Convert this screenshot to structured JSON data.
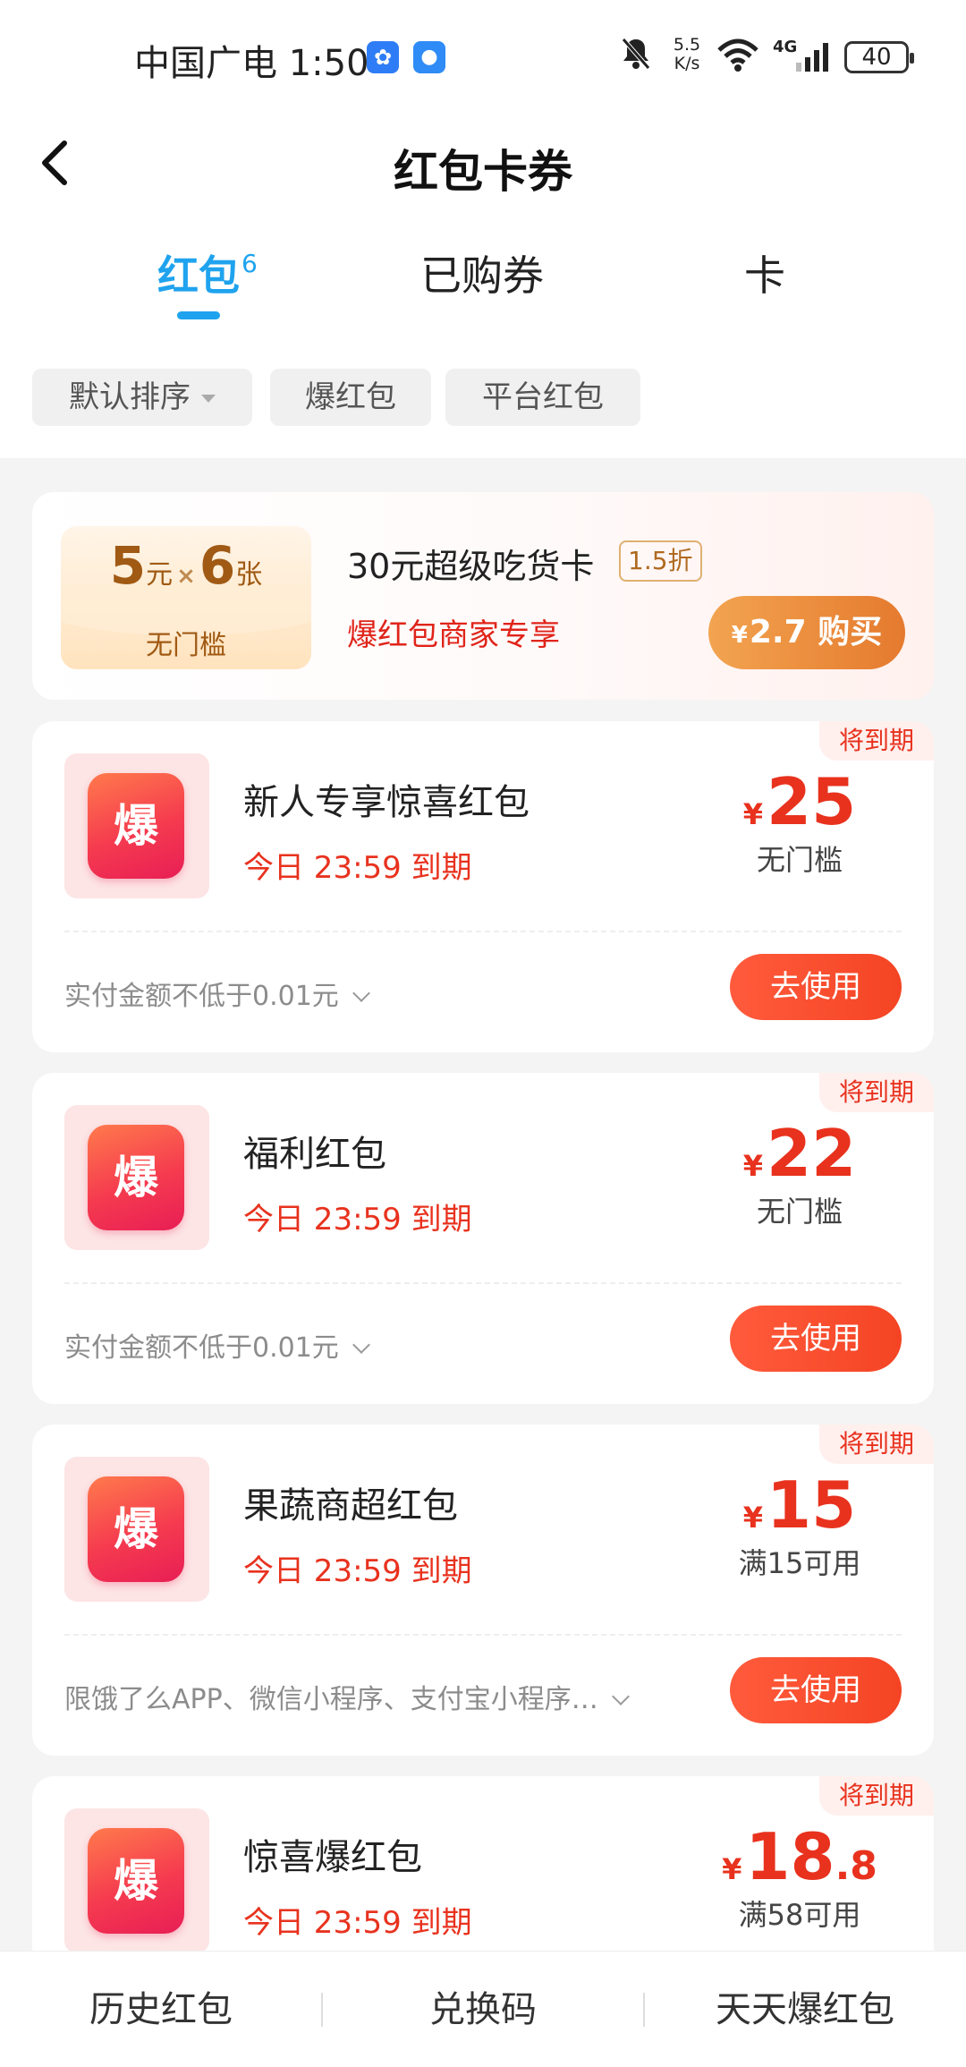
{
  "status_bar": {
    "carrier": "中国广电",
    "time": "1:50",
    "net_speed_value": "5.5",
    "net_speed_unit": "K/s",
    "network_type": "4G",
    "battery": "40"
  },
  "header": {
    "title": "红包卡券"
  },
  "tabs": [
    {
      "label": "红包",
      "badge": "6",
      "active": true
    },
    {
      "label": "已购券",
      "active": false
    },
    {
      "label": "卡",
      "active": false
    }
  ],
  "filters": [
    {
      "label": "默认排序",
      "has_dropdown": true
    },
    {
      "label": "爆红包"
    },
    {
      "label": "平台红包"
    }
  ],
  "promo": {
    "amount": "5",
    "amount_unit": "元",
    "times": "×",
    "count": "6",
    "count_unit": "张",
    "ticket_sub": "无门槛",
    "title": "30元超级吃货卡",
    "discount": "1.5折",
    "desc": "爆红包商家专享",
    "btn_currency": "¥",
    "btn_price": "2.7",
    "btn_action": "购买"
  },
  "coupons": [
    {
      "tag": "将到期",
      "logo_char": "爆",
      "name": "新人专享惊喜红包",
      "expire": "今日 23:59 到期",
      "currency": "¥",
      "amount": "25",
      "amount_decimal": "",
      "condition": "无门槛",
      "rule": "实付金额不低于0.01元",
      "use_label": "去使用"
    },
    {
      "tag": "将到期",
      "logo_char": "爆",
      "name": "福利红包",
      "expire": "今日 23:59 到期",
      "currency": "¥",
      "amount": "22",
      "amount_decimal": "",
      "condition": "无门槛",
      "rule": "实付金额不低于0.01元",
      "use_label": "去使用"
    },
    {
      "tag": "将到期",
      "logo_char": "爆",
      "name": "果蔬商超红包",
      "expire": "今日 23:59 到期",
      "currency": "¥",
      "amount": "15",
      "amount_decimal": "",
      "condition": "满15可用",
      "rule": "限饿了么APP、微信小程序、支付宝小程序…",
      "use_label": "去使用"
    },
    {
      "tag": "将到期",
      "logo_char": "爆",
      "name": "惊喜爆红包",
      "expire": "今日 23:59 到期",
      "currency": "¥",
      "amount": "18",
      "amount_decimal": ".8",
      "condition": "满58可用"
    }
  ],
  "bottom_bar": [
    {
      "label": "历史红包"
    },
    {
      "label": "兑换码"
    },
    {
      "label": "天天爆红包"
    }
  ],
  "colors": {
    "accent_blue": "#1fa3ee",
    "coupon_red": "#e8321e",
    "promo_orange": "#e57a2e"
  }
}
